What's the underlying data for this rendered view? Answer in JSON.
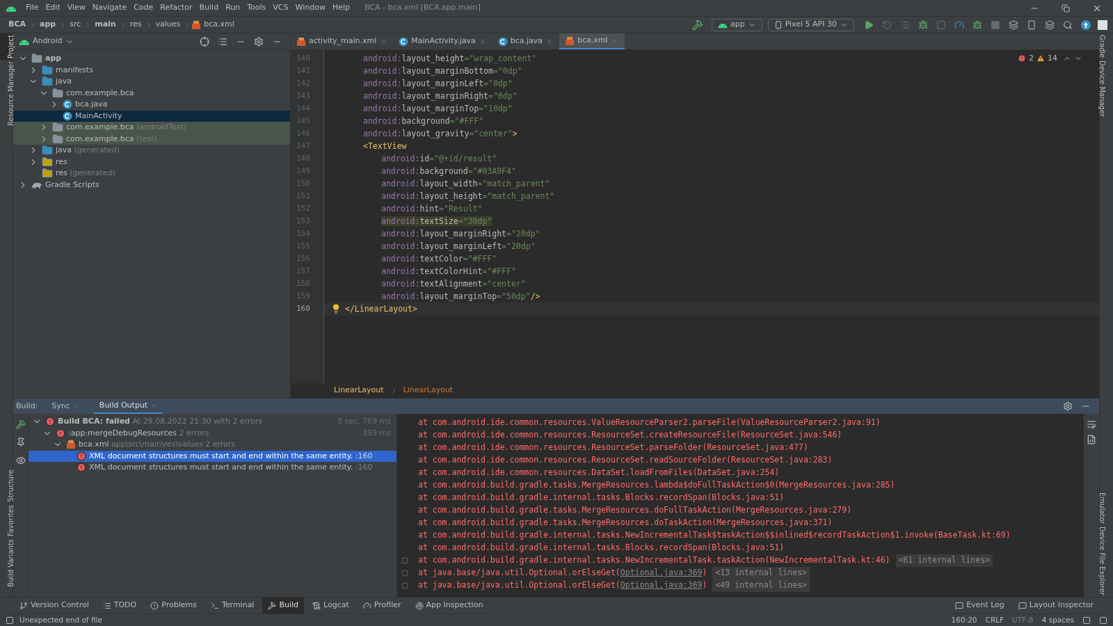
{
  "menu": [
    "File",
    "Edit",
    "View",
    "Navigate",
    "Code",
    "Refactor",
    "Build",
    "Run",
    "Tools",
    "VCS",
    "Window",
    "Help"
  ],
  "window": {
    "title": "BCA - bca.xml [BCA.app.main]"
  },
  "breadcrumb": [
    "BCA",
    "app",
    "src",
    "main",
    "res",
    "values",
    "bca.xml"
  ],
  "run_config": "app",
  "device": "Pixel 5 API 30",
  "left_stripe": [
    {
      "label": "Project",
      "selected": true
    },
    {
      "label": "Resource Manager",
      "selected": false
    }
  ],
  "left_stripe_bottom": [
    {
      "label": "Structure",
      "selected": false
    },
    {
      "label": "Favorites",
      "selected": false
    },
    {
      "label": "Build Variants",
      "selected": false
    }
  ],
  "right_stripe": [
    {
      "label": "Gradle"
    },
    {
      "label": "Device Manager"
    }
  ],
  "right_stripe_bottom": [
    {
      "label": "Emulator"
    },
    {
      "label": "Device File Explorer"
    }
  ],
  "project": {
    "view": "Android",
    "tree": [
      {
        "label": "app",
        "kind": "module",
        "expanded": true,
        "children": [
          {
            "label": "manifests",
            "kind": "folder",
            "expanded": false
          },
          {
            "label": "java",
            "kind": "folder",
            "expanded": true,
            "children": [
              {
                "label": "com.example.bca",
                "kind": "package",
                "expanded": true,
                "children": [
                  {
                    "label": "bca.java",
                    "kind": "class",
                    "expanded": false,
                    "selected": false
                  },
                  {
                    "label": "MainActivity",
                    "kind": "class",
                    "selected": true
                  }
                ]
              },
              {
                "label": "com.example.bca",
                "note": "(androidTest)",
                "kind": "package",
                "expanded": false,
                "test": true
              },
              {
                "label": "com.example.bca",
                "note": "(test)",
                "kind": "package",
                "expanded": false,
                "test": true
              }
            ]
          },
          {
            "label": "java",
            "note": "(generated)",
            "kind": "folder",
            "expanded": false
          },
          {
            "label": "res",
            "kind": "res",
            "expanded": false
          },
          {
            "label": "res",
            "note": "(generated)",
            "kind": "res"
          }
        ]
      },
      {
        "label": "Gradle Scripts",
        "kind": "gradle",
        "expanded": false
      }
    ]
  },
  "tabs": [
    {
      "label": "activity_main.xml",
      "kind": "xml",
      "selected": false
    },
    {
      "label": "MainActivity.java",
      "kind": "class",
      "selected": false
    },
    {
      "label": "bca.java",
      "kind": "class",
      "selected": false
    },
    {
      "label": "bca.xml",
      "kind": "xml",
      "selected": true
    }
  ],
  "inspections": {
    "errors": "2",
    "warnings": "14"
  },
  "code_body": [
    {
      "n": "140",
      "kind": "attribute",
      "text": "android:layout_height=\"wrap_content\""
    },
    {
      "n": "141",
      "kind": "attribute",
      "text": "android:layout_marginBottom=\"0dp\""
    },
    {
      "n": "142",
      "kind": "attribute",
      "text": "android:layout_marginLeft=\"0dp\""
    },
    {
      "n": "143",
      "kind": "attribute",
      "text": "android:layout_marginRight=\"0dp\""
    },
    {
      "n": "144",
      "kind": "attribute",
      "text": "android:layout_marginTop=\"10dp\""
    },
    {
      "n": "145",
      "kind": "attribute",
      "text": "android:background=\"#FFF\""
    },
    {
      "n": "146",
      "kind": "attribute",
      "text": "android:layout_gravity=\"center\">"
    },
    {
      "n": "147",
      "kind": "tag",
      "text": "<TextView",
      "children": [
        {
          "n": "148",
          "kind": "attribute",
          "text": "android:id=\"@+id/result\""
        },
        {
          "n": "149",
          "kind": "attribute",
          "text": "android:background=\"#03A9F4\""
        },
        {
          "n": "150",
          "kind": "attribute",
          "text": "android:layout_width=\"match_parent\""
        },
        {
          "n": "151",
          "kind": "attribute",
          "text": "android:layout_height=\"match_parent\""
        },
        {
          "n": "152",
          "kind": "attribute",
          "text": "android:hint=\"Result\""
        },
        {
          "n": "153",
          "kind": "attribute",
          "text": "android:textSize=\"30dp\"",
          "highlighted": true
        },
        {
          "n": "154",
          "kind": "attribute",
          "text": "android:layout_marginRight=\"20dp\""
        },
        {
          "n": "155",
          "kind": "attribute",
          "text": "android:layout_marginLeft=\"20dp\""
        },
        {
          "n": "156",
          "kind": "attribute",
          "text": "android:textColor=\"#FFF\""
        },
        {
          "n": "157",
          "kind": "attribute",
          "text": "android:textColorHint=\"#FFF\""
        },
        {
          "n": "158",
          "kind": "attribute",
          "text": "android:textAlignment=\"center\""
        },
        {
          "n": "159",
          "kind": "attribute",
          "text": "android:layout_marginTop=\"50dp\"/>"
        }
      ]
    }
  ],
  "code_end": {
    "n": "160",
    "kind": "tag",
    "text": "</LinearLayout>",
    "current": true
  },
  "editor_breadcrumb": [
    "LinearLayout",
    "LinearLayout"
  ],
  "build": {
    "label": "Build:",
    "tabs": [
      {
        "label": "Sync",
        "selected": false
      },
      {
        "label": "Build Output",
        "selected": true
      }
    ],
    "tree": [
      {
        "title": "Build BCA:",
        "status": "failed",
        "detail": "At 29.08.2022 21:30 with 2 errors",
        "time": "3 sec, 769 ms",
        "kind": "error",
        "children": [
          {
            "title": ":app:mergeDebugResources",
            "detail": "2 errors",
            "time": "359 ms",
            "kind": "error",
            "children": [
              {
                "title": "bca.xml",
                "detail": "app\\src\\main\\res\\values 2 errors",
                "kind": "file",
                "children": [
                  {
                    "title": "XML document structures must start and end within the same entity.",
                    "detail": ":160",
                    "kind": "error",
                    "selected": true
                  },
                  {
                    "title": "XML document structures must start and end within the same entity.",
                    "detail": ":160",
                    "kind": "error",
                    "selected": false
                  }
                ]
              }
            ]
          }
        ]
      }
    ],
    "output": [
      {
        "text": "at com.android.ide.common.resources.ValueResourceParser2.parseFile(ValueResourceParser2.java:91)"
      },
      {
        "text": "at com.android.ide.common.resources.ResourceSet.createResourceFile(ResourceSet.java:546)"
      },
      {
        "text": "at com.android.ide.common.resources.ResourceSet.parseFolder(ResourceSet.java:477)"
      },
      {
        "text": "at com.android.ide.common.resources.ResourceSet.readSourceFolder(ResourceSet.java:283)"
      },
      {
        "text": "at com.android.ide.common.resources.DataSet.loadFromFiles(DataSet.java:254)"
      },
      {
        "text": "at com.android.build.gradle.tasks.MergeResources.lambda$doFullTaskAction$0(MergeResources.java:285)"
      },
      {
        "text": "at com.android.build.gradle.internal.tasks.Blocks.recordSpan(Blocks.java:51)"
      },
      {
        "text": "at com.android.build.gradle.tasks.MergeResources.doFullTaskAction(MergeResources.java:279)"
      },
      {
        "text": "at com.android.build.gradle.tasks.MergeResources.doTaskAction(MergeResources.java:371)"
      },
      {
        "text": "at com.android.build.gradle.internal.tasks.NewIncrementalTask$taskAction$$inlined$recordTaskAction$1.invoke(BaseTask.kt:69)"
      },
      {
        "text": "at com.android.build.gradle.internal.tasks.Blocks.recordSpan(Blocks.java:51)"
      },
      {
        "text": "at com.android.build.gradle.internal.tasks.NewIncrementalTask.taskAction(NewIncrementalTask.kt:46)",
        "fold": "<61 internal lines>",
        "expander": true
      },
      {
        "text": "at java.base/java.util.Optional.orElseGet(",
        "link": "Optional.java:369",
        "after": ")",
        "fold": "<13 internal lines>",
        "expander": true
      },
      {
        "text": "at java.base/java.util.Optional.orElseGet(",
        "link": "Optional.java:369",
        "after": ")",
        "fold": "<49 internal lines>",
        "expander": true
      }
    ]
  },
  "toolwindows": [
    {
      "label": "Version Control",
      "selected": false
    },
    {
      "label": "TODO",
      "selected": false
    },
    {
      "label": "Problems",
      "selected": false
    },
    {
      "label": "Terminal",
      "selected": false
    },
    {
      "label": "Build",
      "selected": true
    },
    {
      "label": "Logcat",
      "selected": false
    },
    {
      "label": "Profiler",
      "selected": false
    },
    {
      "label": "App Inspection",
      "selected": false
    }
  ],
  "toolwindows_right": [
    "Event Log",
    "Layout Inspector"
  ],
  "status": {
    "message": "Unexpected end of file",
    "position": "160:20",
    "line_sep": "CRLF",
    "encoding": "UTF-8",
    "indent": "4 spaces"
  }
}
